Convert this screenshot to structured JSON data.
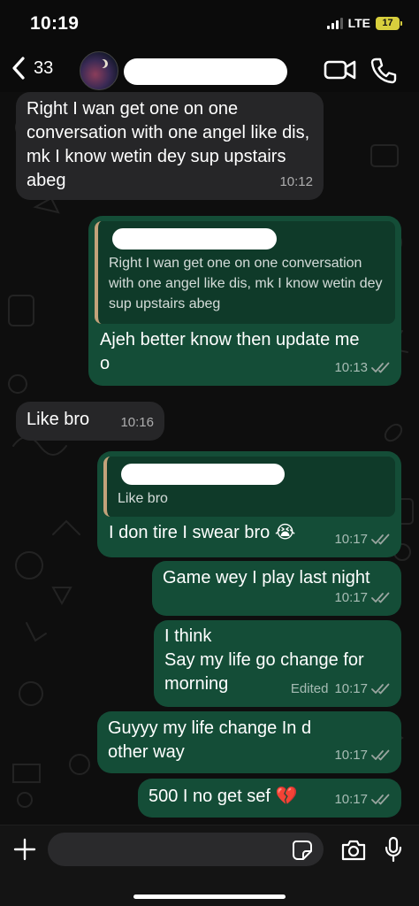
{
  "status_bar": {
    "time": "10:19",
    "network": "LTE",
    "battery": "17"
  },
  "header": {
    "unread_count": "33",
    "icons": [
      "back-chevron-icon",
      "video-call-icon",
      "phone-call-icon"
    ]
  },
  "messages": [
    {
      "direction": "in",
      "text": "Right I wan get one on one conversation with one angel like dis, mk I know wetin dey sup upstairs abeg",
      "time": "10:12"
    },
    {
      "direction": "out",
      "quote": "Right I wan get one on one conversation with one angel like dis, mk I know wetin dey sup upstairs abeg",
      "text": "Ajeh better know then update me o",
      "time": "10:13"
    },
    {
      "direction": "in",
      "text": "Like bro",
      "time": "10:16"
    },
    {
      "direction": "out",
      "quote": "Like bro",
      "text": "I don tire I swear bro 😭",
      "time": "10:17"
    },
    {
      "direction": "out",
      "text": "Game wey I play last night",
      "time": "10:17"
    },
    {
      "direction": "out",
      "text": "I think\nSay my life go change for morning",
      "edited": "Edited",
      "time": "10:17"
    },
    {
      "direction": "out",
      "text": "Guyyy my life change In d other way",
      "time": "10:17"
    },
    {
      "direction": "out",
      "text": "500 I no get sef 💔",
      "time": "10:17"
    }
  ],
  "composer": {
    "placeholder": "",
    "icons": [
      "plus-icon",
      "sticker-icon",
      "camera-icon",
      "microphone-icon"
    ]
  },
  "colors": {
    "incoming_bubble": "#262628",
    "outgoing_bubble": "#144d37",
    "quote_bar": "#c3a27a",
    "read_ticks": "#9aa5a0"
  }
}
